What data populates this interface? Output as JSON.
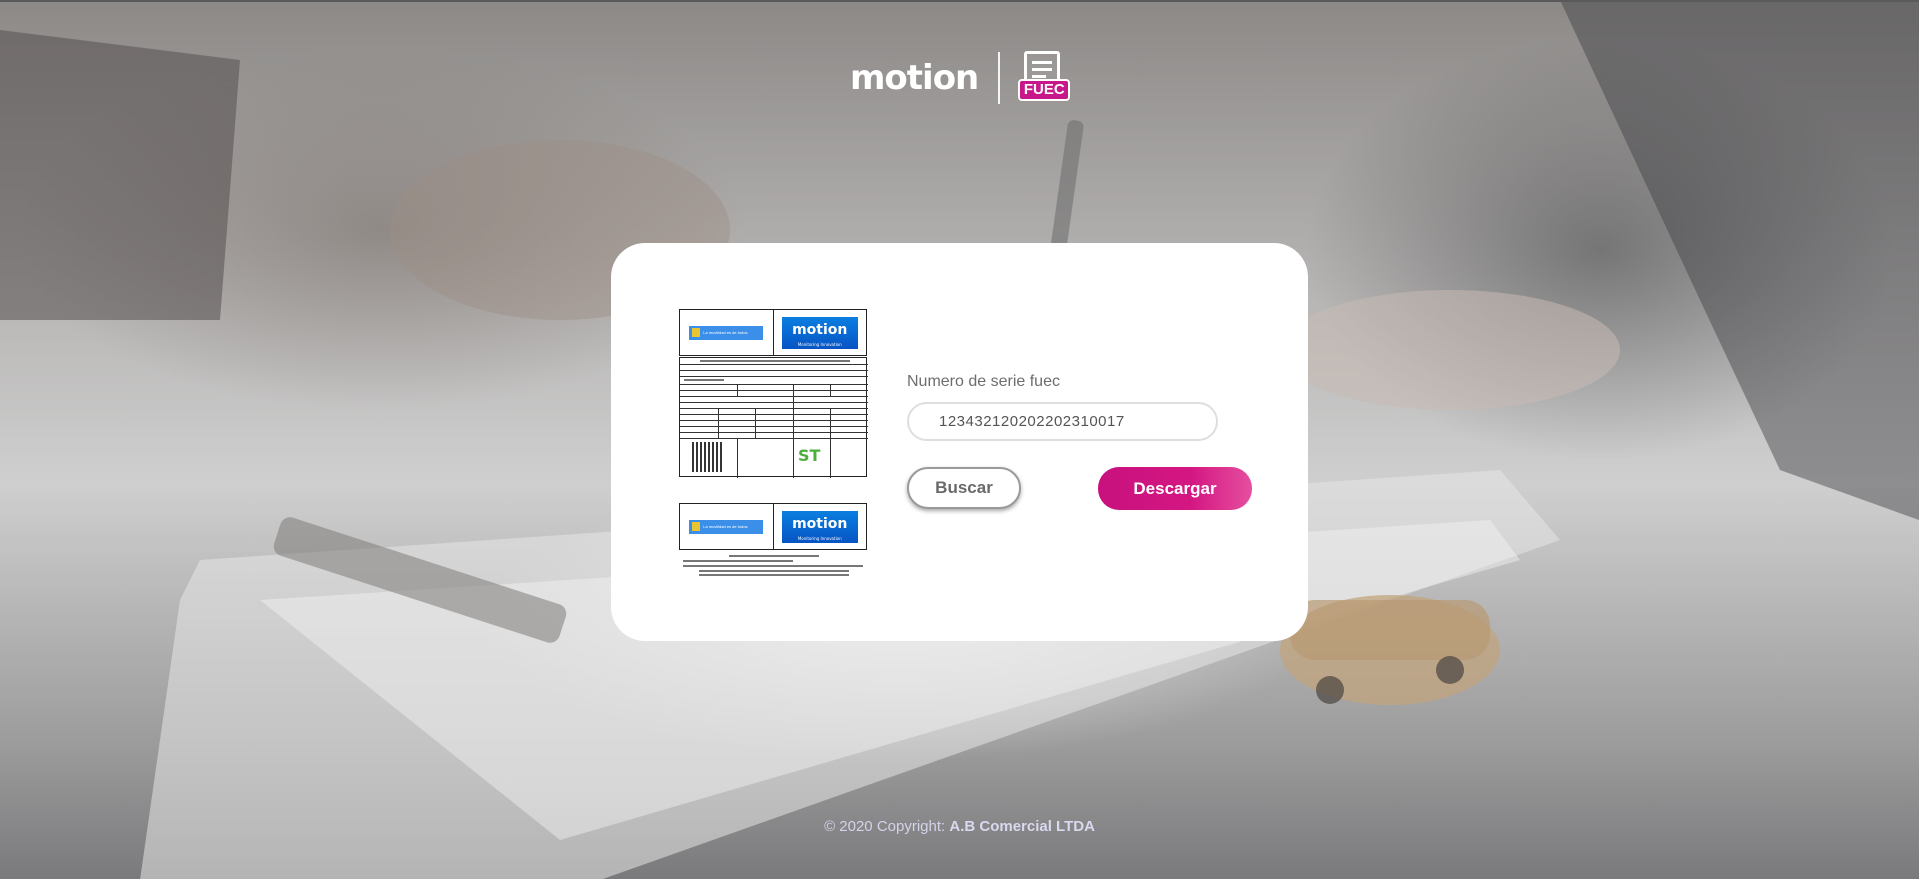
{
  "header": {
    "brand_name": "motion",
    "brand_accent_color": "#e0197d",
    "product_badge": "FUEC"
  },
  "document_preview": {
    "gov_badge_text": "La movilidad es de todos",
    "motion_badge_text": "motion",
    "motion_badge_sub": "Monitoring Innovation",
    "st_logo_text": "ST"
  },
  "search": {
    "label": "Numero de serie fuec",
    "value": "12343212020220231​0017",
    "search_button": "Buscar",
    "download_button": "Descargar"
  },
  "footer": {
    "copyright": "© 2020 Copyright: ",
    "company": "A.B Comercial LTDA"
  },
  "colors": {
    "primary": "#d41682",
    "card_bg": "#ffffff"
  }
}
